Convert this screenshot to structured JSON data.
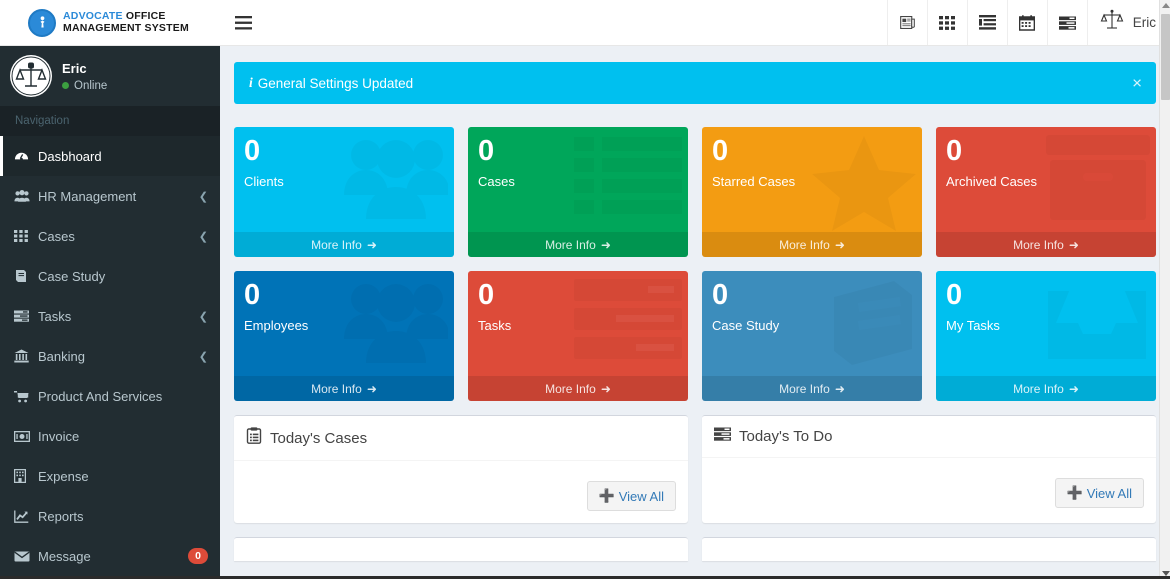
{
  "brand": {
    "line1_accent": "ADVOCATE",
    "line1_rest": " OFFICE",
    "line2": "MANAGEMENT SYSTEM",
    "accent_color": "#2b8ad8"
  },
  "header": {
    "toggle_icon": "hamburger-icon",
    "icons": [
      {
        "name": "news-icon"
      },
      {
        "name": "grid-apps-icon"
      },
      {
        "name": "list-indent-icon"
      },
      {
        "name": "calendar-icon"
      },
      {
        "name": "server-list-icon"
      }
    ],
    "user_name": "Eric",
    "user_avatar_icon": "scales-of-justice-icon"
  },
  "sidebar": {
    "user": {
      "name": "Eric",
      "status": "Online",
      "status_color": "#3c9f40",
      "avatar_icon": "scales-of-justice-avatar"
    },
    "nav_header": "Navigation",
    "items": [
      {
        "label": "Dasbhoard",
        "icon": "dashboard-icon",
        "active": true,
        "caret": false,
        "badge": null
      },
      {
        "label": "HR Management",
        "icon": "users-group-icon",
        "active": false,
        "caret": true,
        "badge": null
      },
      {
        "label": "Cases",
        "icon": "grid-icon",
        "active": false,
        "caret": true,
        "badge": null
      },
      {
        "label": "Case Study",
        "icon": "book-icon",
        "active": false,
        "caret": false,
        "badge": null
      },
      {
        "label": "Tasks",
        "icon": "tasks-icon",
        "active": false,
        "caret": true,
        "badge": null
      },
      {
        "label": "Banking",
        "icon": "bank-icon",
        "active": false,
        "caret": true,
        "badge": null
      },
      {
        "label": "Product And Services",
        "icon": "cart-icon",
        "active": false,
        "caret": false,
        "badge": null
      },
      {
        "label": "Invoice",
        "icon": "money-bill-icon",
        "active": false,
        "caret": false,
        "badge": null
      },
      {
        "label": "Expense",
        "icon": "building-icon",
        "active": false,
        "caret": false,
        "badge": null
      },
      {
        "label": "Reports",
        "icon": "chart-line-icon",
        "active": false,
        "caret": false,
        "badge": null
      },
      {
        "label": "Message",
        "icon": "envelope-icon",
        "active": false,
        "caret": false,
        "badge": "0"
      }
    ]
  },
  "alert": {
    "icon": "info-icon",
    "text": "General Settings Updated",
    "close_label": "×",
    "bg_color": "#00c0ef"
  },
  "cards": [
    {
      "number": "0",
      "label": "Clients",
      "more": "More Info",
      "color": "#00c0ef",
      "icon": "users-icon"
    },
    {
      "number": "0",
      "label": "Cases",
      "more": "More Info",
      "color": "#00a65a",
      "icon": "th-list-icon"
    },
    {
      "number": "0",
      "label": "Starred Cases",
      "more": "More Info",
      "color": "#f39c12",
      "icon": "star-icon"
    },
    {
      "number": "0",
      "label": "Archived Cases",
      "more": "More Info",
      "color": "#dd4b39",
      "icon": "archive-icon"
    },
    {
      "number": "0",
      "label": "Employees",
      "more": "More Info",
      "color": "#0073b7",
      "icon": "users-icon"
    },
    {
      "number": "0",
      "label": "Tasks",
      "more": "More Info",
      "color": "#dd4b39",
      "icon": "tasks-bars-icon"
    },
    {
      "number": "0",
      "label": "Case Study",
      "more": "More Info",
      "color": "#3c8dbc",
      "icon": "book-icon"
    },
    {
      "number": "0",
      "label": "My Tasks",
      "more": "More Info",
      "color": "#00c0ef",
      "icon": "inbox-icon"
    }
  ],
  "panels": [
    {
      "title": "Today's Cases",
      "icon": "clipboard-list-icon",
      "button": "View All",
      "button_icon": "plus-icon"
    },
    {
      "title": "Today's To Do",
      "icon": "server-list-icon",
      "button": "View All",
      "button_icon": "plus-icon"
    }
  ]
}
